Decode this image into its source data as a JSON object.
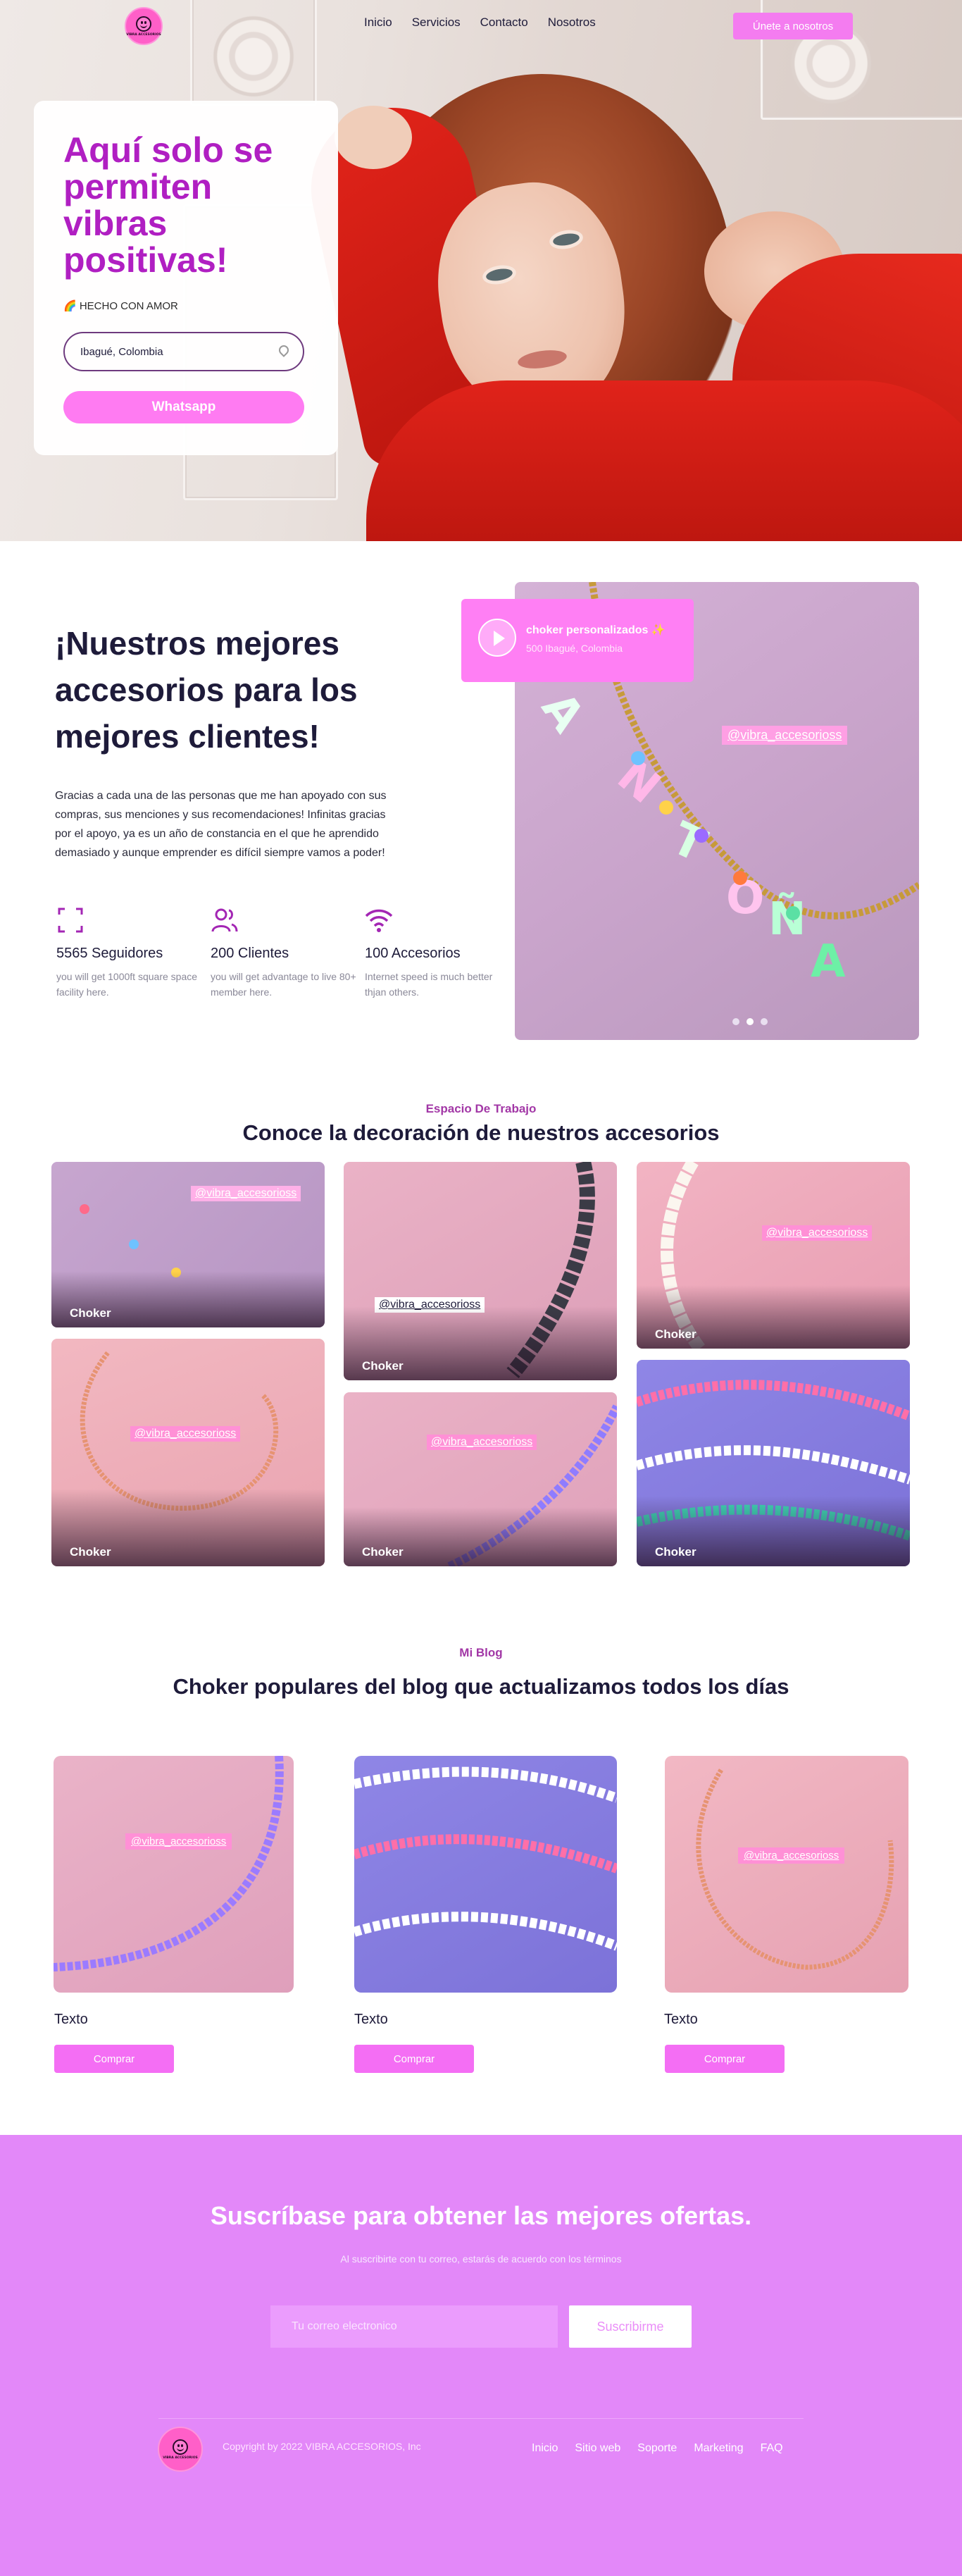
{
  "nav": {
    "logo_text": "VIBRA ACCESORIOS",
    "links": [
      "Inicio",
      "Servicios",
      "Contacto",
      "Nosotros"
    ],
    "cta": "Únete a nosotros"
  },
  "hero": {
    "title": "Aquí solo se permiten vibras positivas!",
    "tag": "🌈 HECHO CON AMOR",
    "location": "Ibagué, Colombia",
    "button": "Whatsapp"
  },
  "about": {
    "title": "¡Nuestros mejores accesorios para los mejores clientes!",
    "text": "Gracias a cada una de las personas que me han apoyado con sus compras, sus menciones y sus recomendaciones! Infinitas gracias por el apoyo, ya es un año de constancia en el que he aprendido demasiado y aunque emprender es difícil siempre vamos a poder!",
    "stats": [
      {
        "value": "5565 Seguidores",
        "desc": "you will get 1000ft square space facility here.",
        "icon": "expand-icon"
      },
      {
        "value": "200 Clientes",
        "desc": "you will get advantage to live 80+ member here.",
        "icon": "users-icon"
      },
      {
        "value": "100 Accesorios",
        "desc": "Internet speed is much better thjan others.",
        "icon": "wifi-icon"
      }
    ],
    "video_title": "choker personalizados ✨",
    "video_sub": "500 Ibagué, Colombia",
    "watermark": "@vibra_accesorioss"
  },
  "gallery": {
    "eyebrow": "Espacio De Trabajo",
    "title": "Conoce la decoración de nuestros accesorios",
    "items": [
      {
        "caption": "Choker",
        "watermark": "@vibra_accesorioss"
      },
      {
        "caption": "Choker",
        "watermark": "@vibra_accesorioss"
      },
      {
        "caption": "Choker",
        "watermark": "@vibra_accesorioss"
      },
      {
        "caption": "Choker",
        "watermark": "@vibra_accesorioss"
      },
      {
        "caption": "Choker",
        "watermark": "@vibra_accesorioss"
      },
      {
        "caption": "Choker",
        "watermark": ""
      }
    ]
  },
  "blog": {
    "eyebrow": "Mi Blog",
    "title": "Choker populares del blog que actualizamos todos los días",
    "posts": [
      {
        "label": "Texto",
        "button": "Comprar",
        "watermark": "@vibra_accesorioss"
      },
      {
        "label": "Texto",
        "button": "Comprar",
        "watermark": ""
      },
      {
        "label": "Texto",
        "button": "Comprar",
        "watermark": "@vibra_accesorioss"
      }
    ]
  },
  "subscribe": {
    "title": "Suscríbase para obtener las mejores ofertas.",
    "note": "Al suscribirte con tu correo, estarás de acuerdo con los términos",
    "placeholder": "Tu correo electronico",
    "button": "Suscribirme"
  },
  "footer": {
    "copyright": "Copyright by 2022 VIBRA ACCESORIOS, Inc",
    "links": [
      "Inicio",
      "Sitio web",
      "Soporte",
      "Marketing",
      "FAQ"
    ]
  },
  "colors": {
    "accent": "#f47cf0",
    "title_purple": "#b01fc2",
    "footer_bg": "#e388f9"
  }
}
